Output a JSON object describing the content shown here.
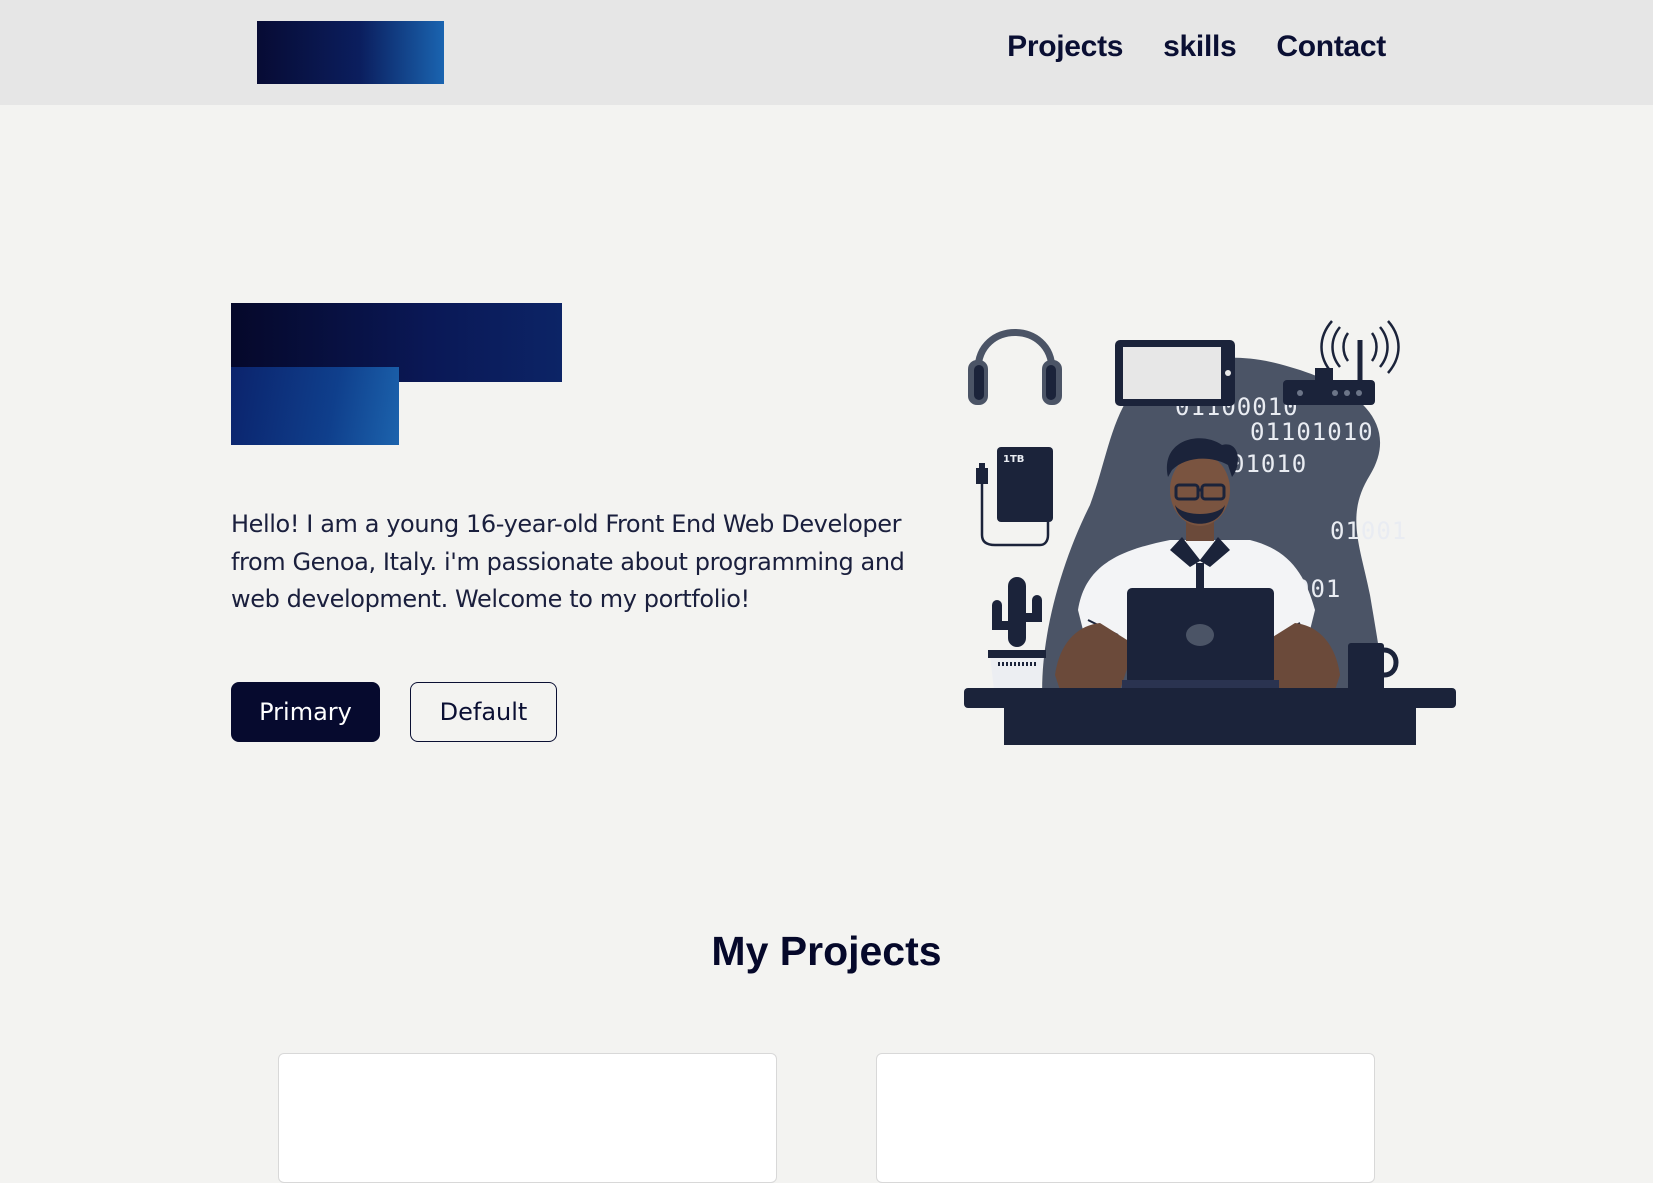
{
  "nav": {
    "links": [
      "Projects",
      "skills",
      "Contact"
    ]
  },
  "hero": {
    "intro": "Hello! I am a young 16-year-old Front End Web Developer from Genoa, Italy. i'm passionate about programming and web development. Welcome to my portfolio!",
    "primary_button": "Primary",
    "default_button": "Default",
    "illustration": {
      "binary_lines": [
        "01100010",
        "01101010",
        "01010",
        "01001",
        "001"
      ],
      "drive_label": "1TB"
    }
  },
  "projects": {
    "title": "My Projects"
  },
  "colors": {
    "navy": "#060a2e",
    "navbar_bg": "#e6e6e6",
    "page_bg": "#f3f3f1",
    "illustration_slate": "#4b5466",
    "illustration_dark": "#141c33"
  }
}
